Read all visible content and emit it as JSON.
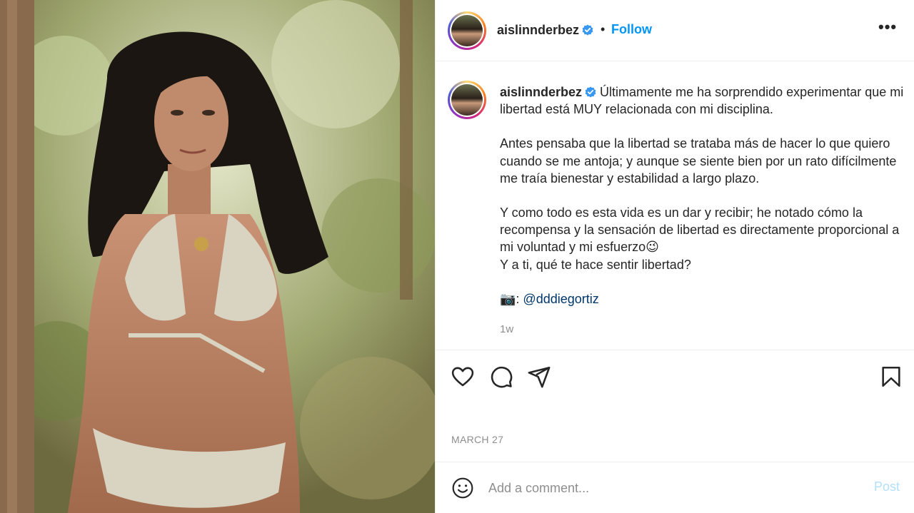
{
  "header": {
    "username": "aislinnderbez",
    "verified_icon": "verified-badge-icon",
    "separator": "•",
    "follow_label": "Follow",
    "more_icon": "more-options-icon",
    "more_label": "•••"
  },
  "caption": {
    "username": "aislinnderbez",
    "paragraph1": "Últimamente me ha sorprendido experimentar que mi libertad está MUY relacionada con mi disciplina.",
    "paragraph2": "Antes pensaba que la libertad se trataba más de hacer lo que quiero cuando se me antoja; y aunque se siente bien por un rato difícilmente me traía bienestar y estabilidad a largo plazo.",
    "paragraph3": "Y como todo es esta vida es un dar y recibir; he notado cómo la recompensa y la sensación de libertad es directamente proporcional a mi voluntad y mi esfuerzo😉",
    "paragraph3b": "Y a ti, qué te hace sentir libertad?",
    "credit_prefix": "📷: ",
    "credit_mention": "@dddiegortiz",
    "time_ago": "1w"
  },
  "actions": {
    "like_icon": "heart-icon",
    "comment_icon": "comment-icon",
    "share_icon": "share-icon",
    "save_icon": "bookmark-icon"
  },
  "post_date": "MARCH 27",
  "comment": {
    "emoji_icon": "emoji-icon",
    "placeholder": "Add a comment...",
    "post_label": "Post"
  },
  "colors": {
    "follow": "#0095f6",
    "post_disabled": "#b2dffc",
    "mention": "#00376b",
    "muted": "#8e8e8e"
  }
}
